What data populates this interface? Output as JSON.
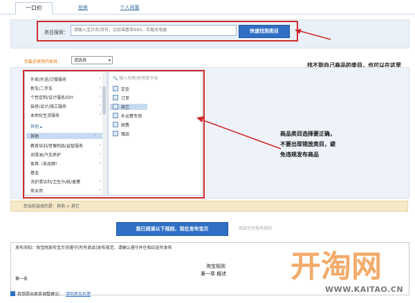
{
  "tabs": [
    {
      "label": "一口价"
    },
    {
      "label": "拍卖"
    },
    {
      "label": "个人闲置"
    }
  ],
  "search": {
    "label": "类目搜索：",
    "placeholder": "请输入宝贝名/货号，比如诺基亚N95，车载充电器",
    "button": "快速找到类目"
  },
  "used": {
    "label": "您最近使用的类目：",
    "select_value": "请选择"
  },
  "categories": {
    "col1": [
      "外卖/外送/订餐服务",
      "新车/二手车",
      "个性定制/设计服务/DIY",
      "装修/设计/施工服务",
      "本地化生活服务",
      "其他",
      "其他",
      "教育培训/音像制品/益智服务",
      "润滑油/汽车养护",
      "家具（非品牌）",
      "基金",
      "洗护清洁剂/卫生巾/纸/香薰",
      "商业用"
    ],
    "col1_selected_index": 6,
    "col1_group_header": "其他",
    "col2_search_placeholder": "输入名称/拼音首字母",
    "col2": [
      "定金",
      "订单",
      "其它",
      "补运费专用",
      "邮费",
      "赠品"
    ],
    "col2_selected_index": 2
  },
  "selected_path": "您当前选择的是：其他 > 其它",
  "confirm": {
    "button": "我已阅读以下规则，现在发布宝贝",
    "link": "阅读空间发布规则"
  },
  "agreement": {
    "note": "发布须知：淘宝网发布宝贝须遵守[所有商品]发布规范，请确认遵守并在相应处所发布",
    "title1": "淘宝规则",
    "title2": "第一章  概述",
    "section": "第一条"
  },
  "footer": {
    "text": "我想提出类目调整建议：",
    "link": "请到意见反馈"
  },
  "annotations": {
    "note_top": "找不到自己商品的类目，也可以在这里输入类目关键字来快速搜索对应类目哦",
    "note_mid": "商品类目选择要正确，不要出现错放类目，避免违规发布商品"
  },
  "watermark": {
    "logo": "开淘网",
    "url": "WWW.KAITAO.CN"
  },
  "colors": {
    "accent": "#2f6fc4",
    "annotation": "#d32a2a",
    "watermark": "#f2a25a"
  }
}
